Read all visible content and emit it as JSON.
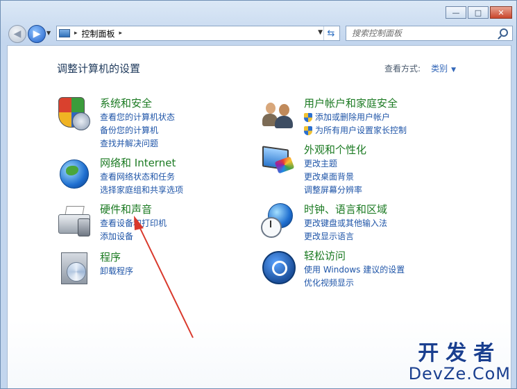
{
  "window": {
    "minimize_symbol": "—",
    "maximize_symbol": "□",
    "close_symbol": "✕"
  },
  "navigation": {
    "back_symbol": "◀",
    "forward_symbol": "▶",
    "recent_symbol": "▼",
    "address": {
      "separator": "▸",
      "location": "控制面板",
      "dropdown_symbol": "▼",
      "refresh_symbol": "⇆"
    },
    "search": {
      "placeholder": "搜索控制面板"
    }
  },
  "header": {
    "title": "调整计算机的设置",
    "view_by_label": "查看方式:",
    "view_by_value": "类别",
    "view_by_arrow": "▼"
  },
  "categories": [
    {
      "title": "系统和安全",
      "links": [
        "查看您的计算机状态",
        "备份您的计算机",
        "查找并解决问题"
      ]
    },
    {
      "title": "网络和 Internet",
      "links": [
        "查看网络状态和任务",
        "选择家庭组和共享选项"
      ]
    },
    {
      "title": "硬件和声音",
      "links": [
        "查看设备和打印机",
        "添加设备"
      ]
    },
    {
      "title": "程序",
      "links": [
        "卸载程序"
      ]
    },
    {
      "title": "用户帐户和家庭安全",
      "links": [
        "添加或删除用户帐户",
        "为所有用户设置家长控制"
      ]
    },
    {
      "title": "外观和个性化",
      "links": [
        "更改主题",
        "更改桌面背景",
        "调整屏幕分辨率"
      ]
    },
    {
      "title": "时钟、语言和区域",
      "links": [
        "更改键盘或其他输入法",
        "更改显示语言"
      ]
    },
    {
      "title": "轻松访问",
      "links": [
        "使用 Windows 建议的设置",
        "优化视频显示"
      ]
    }
  ],
  "watermark": {
    "line1": "开发者",
    "line2": "DevZe.CoM"
  },
  "colors": {
    "category_title": "#1b7a22",
    "link": "#1f55a8",
    "annotation_arrow": "#d9392c"
  }
}
